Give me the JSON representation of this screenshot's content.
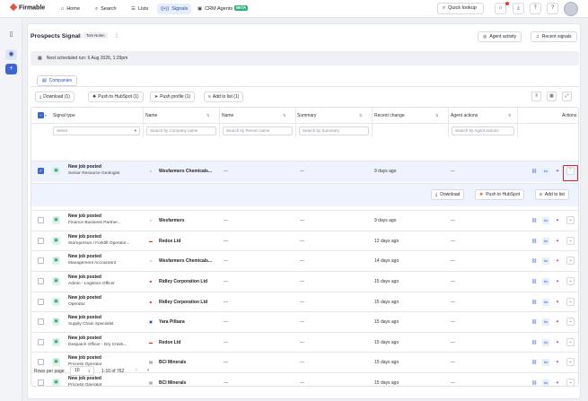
{
  "topbar": {
    "logo": "Firmable",
    "nav": [
      {
        "label": "Home",
        "icon": "home-icon"
      },
      {
        "label": "Search",
        "icon": "search-icon"
      },
      {
        "label": "Lists",
        "icon": "list-icon"
      },
      {
        "label": "Signals",
        "icon": "signal-icon"
      },
      {
        "label": "CRM Agents",
        "icon": "robot-icon",
        "badge": "BETA"
      }
    ],
    "quick_lookup": "Quick lookup"
  },
  "page": {
    "title": "Prospects Signal",
    "owner": "Tom Nolen",
    "buttons": {
      "agent_activity": "Agent activity",
      "recent_signals": "Recent signals"
    },
    "schedule": "Next scheduled run: 6 Aug 2026, 1:29pm",
    "tab": "Companies"
  },
  "actions": {
    "download": "Download (1)",
    "push_hubspot": "Push to HubSpot (1)",
    "push_profile": "Push profile (1)",
    "add_list": "Add to list (1)"
  },
  "table": {
    "headers": {
      "signal_type": "Signal type",
      "name1": "Name",
      "name2": "Name",
      "summary": "Summary",
      "recent_change": "Recent change",
      "agent_actions": "Agent actions",
      "actions": "Actions"
    },
    "filters": {
      "select": "Select",
      "company": "Search by Company name",
      "person": "Search by Person name",
      "summary": "Search by Summary",
      "agent": "Search by Agent actions"
    },
    "dash": "—",
    "rows": [
      {
        "type": "New job posted",
        "title": "Senior Resource Geologist",
        "company": "Wesfarmers Chemicals...",
        "logo": "w",
        "change": "9 days ago",
        "selected": true
      },
      {
        "type": "New job posted",
        "title": "Finance Business Partner...",
        "company": "Wesfarmers",
        "logo": "w",
        "change": "9 days ago",
        "selected": false
      },
      {
        "type": "New job posted",
        "title": "Storeperson / Forklift Operator...",
        "company": "Redox Ltd",
        "logo": "r",
        "change": "12 days ago",
        "selected": false
      },
      {
        "type": "New job posted",
        "title": "Management Accountant",
        "company": "Wesfarmers Chemicals...",
        "logo": "w",
        "change": "14 days ago",
        "selected": false
      },
      {
        "type": "New job posted",
        "title": "Admin - Logistics Officer",
        "company": "Ridley Corporation Ltd",
        "logo": "rd",
        "change": "15 days ago",
        "selected": false
      },
      {
        "type": "New job posted",
        "title": "Operator",
        "company": "Ridley Corporation Ltd",
        "logo": "rd",
        "change": "15 days ago",
        "selected": false
      },
      {
        "type": "New job posted",
        "title": "Supply Chain Specialist",
        "company": "Yara Pilbara",
        "logo": "y",
        "change": "15 days ago",
        "selected": false
      },
      {
        "type": "New job posted",
        "title": "Despatch Officer - Dry Creek...",
        "company": "Redox Ltd",
        "logo": "r",
        "change": "15 days ago",
        "selected": false
      },
      {
        "type": "New job posted",
        "title": "Process Operator",
        "company": "BCI Minerals",
        "logo": "b",
        "change": "15 days ago",
        "selected": false
      },
      {
        "type": "New job posted",
        "title": "Process Operator",
        "company": "BCI Minerals",
        "logo": "b",
        "change": "15 days ago",
        "selected": false
      }
    ],
    "expanded": {
      "download": "Download",
      "push_hubspot": "Push to HubSpot",
      "add_list": "Add to list"
    }
  },
  "pagination": {
    "rows_per_page_label": "Rows per page",
    "rows_per_page": "10",
    "range": "1-10 of 762"
  },
  "colors": {
    "accent": "#3a66d6",
    "brand": "#e8513a",
    "beta": "#2fb07a",
    "highlight": "#e0201c"
  }
}
